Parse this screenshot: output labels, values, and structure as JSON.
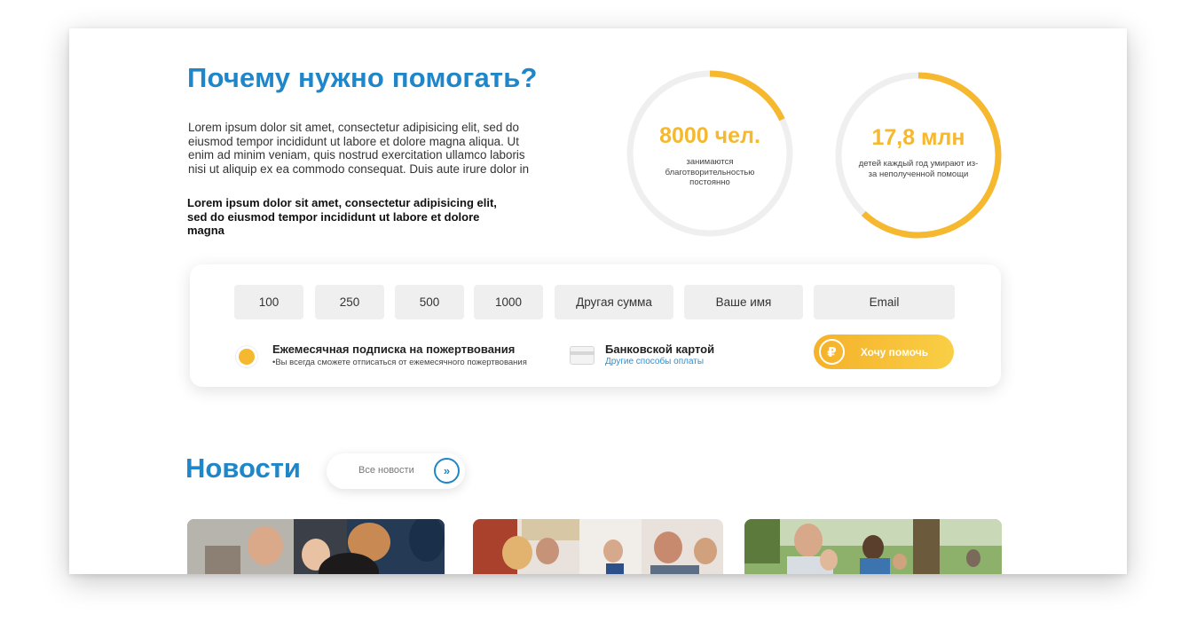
{
  "why": {
    "title": "Почему нужно помогать?",
    "text": "Lorem ipsum dolor sit amet, consectetur adipisicing elit, sed do eiusmod tempor incididunt ut labore et dolore magna aliqua. Ut enim ad minim veniam, quis nostrud exercitation ullamco laboris nisi ut aliquip ex ea commodo consequat. Duis aute irure dolor in",
    "bold_text": "Lorem ipsum dolor sit amet, consectetur adipisicing elit, sed do eiusmod tempor incididunt ut labore et dolore magna"
  },
  "stats": [
    {
      "value": "8000 чел.",
      "description": "занимаются благотворительностью постоянно",
      "fill_fraction": 0.18
    },
    {
      "value": "17,8 млн",
      "description": "детей каждый год умирают из-за неполученной помощи",
      "fill_fraction": 0.62
    }
  ],
  "donation": {
    "amounts": [
      "100",
      "250",
      "500",
      "1000"
    ],
    "other_amount": "Другая сумма",
    "name_placeholder": "Ваше имя",
    "email_placeholder": "Email",
    "subscription_title": "Ежемесячная подписка на пожертвования",
    "subscription_note": "•Вы всегда сможете отписаться от ежемесячного пожертвования",
    "payment_title": "Банковской картой",
    "payment_link": "Другие способы оплаты",
    "currency_symbol": "₽",
    "submit_label": "Хочу помочь"
  },
  "news": {
    "title": "Новости",
    "all_news_label": "Все новости",
    "arrow_glyph": "»"
  },
  "colors": {
    "brand_blue": "#1f86c9",
    "accent_yellow": "#f5b82e",
    "chip_bg": "#efefef",
    "ring_track": "#efefef"
  }
}
